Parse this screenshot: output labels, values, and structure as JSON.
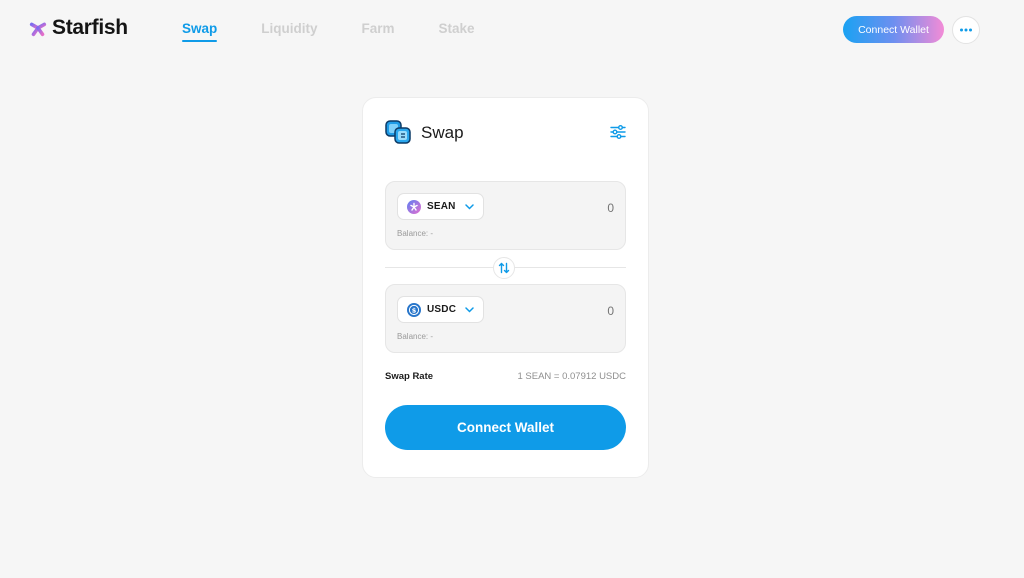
{
  "app": {
    "brand": "Starfish"
  },
  "nav": {
    "items": [
      {
        "label": "Swap",
        "active": true
      },
      {
        "label": "Liquidity",
        "active": false
      },
      {
        "label": "Farm",
        "active": false
      },
      {
        "label": "Stake",
        "active": false
      }
    ]
  },
  "header": {
    "connect_label": "Connect Wallet",
    "more_icon": "ellipsis-icon"
  },
  "swap": {
    "title": "Swap",
    "settings_icon": "sliders-icon",
    "from": {
      "symbol": "SEAN",
      "amount_placeholder": "0",
      "balance": "Balance: -"
    },
    "to": {
      "symbol": "USDC",
      "amount_placeholder": "0",
      "balance": "Balance: -"
    },
    "flip_icon": "swap-arrows-icon",
    "rate_label": "Swap Rate",
    "rate_value": "1 SEAN = 0.07912 USDC",
    "connect_label": "Connect Wallet"
  },
  "colors": {
    "accent": "#0f9be8",
    "background": "#f6f6f6",
    "gradient_start": "#1aa2f2",
    "gradient_end": "#f38bd6"
  }
}
